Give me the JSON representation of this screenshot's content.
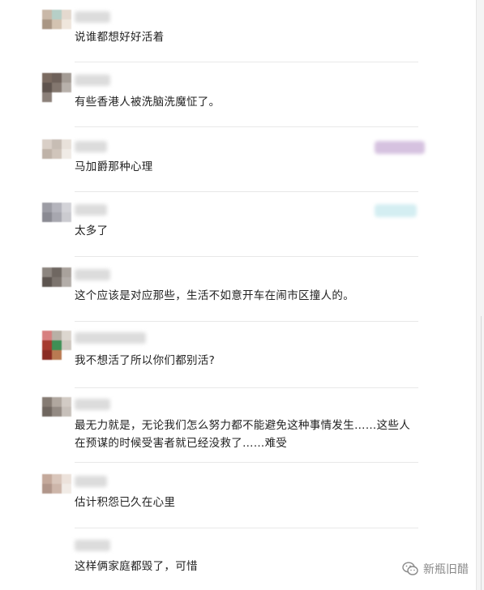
{
  "comments": [
    {
      "text": "说谁都想好好活着"
    },
    {
      "text": "有些香港人被洗脑洗魔怔了。"
    },
    {
      "text": "马加爵那种心理"
    },
    {
      "text": "太多了"
    },
    {
      "text": "这个应该是对应那些，生活不如意开车在闹市区撞人的。"
    },
    {
      "text": "我不想活了所以你们都别活?"
    },
    {
      "text": "最无力就是，无论我们怎么努力都不能避免这种事情发生……这些人在预谋的时候受害者就已经没救了……难受"
    },
    {
      "text": "估计积怨已久在心里"
    },
    {
      "text": "这样俩家庭都毁了，可惜"
    }
  ],
  "watermark": {
    "label": "新瓶旧醋",
    "icon": "wechat-icon"
  }
}
